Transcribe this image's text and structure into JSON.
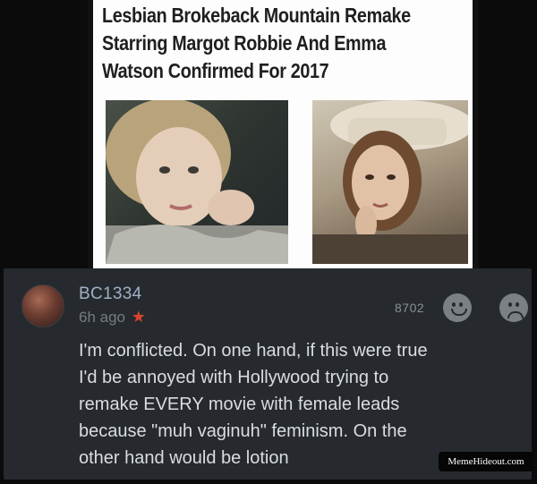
{
  "article": {
    "headline_lines": [
      "Lesbian Brokeback Mountain Remake",
      "Starring Margot Robbie And Emma",
      "Watson Confirmed For 2017"
    ],
    "image_left": "margot-robbie-photo",
    "image_right": "emma-watson-photo"
  },
  "comment": {
    "username": "BC1334",
    "time": "6h ago",
    "star_icon": "star-icon",
    "votes": "8702",
    "reaction_icons": [
      "smiley-icon",
      "sad-face-icon"
    ],
    "text_lines": [
      "I'm conflicted. On one hand, if this were true",
      "I'd be annoyed with Hollywood trying to",
      "remake EVERY movie with female leads",
      "because \"muh vaginuh\" feminism. On the",
      "other hand would be lotion"
    ]
  },
  "watermark": "MemeHideout.com",
  "colors": {
    "background": "#0b0b0b",
    "panel": "#262a2e",
    "username": "#9fb1c6",
    "star": "#d8452d",
    "comment_text": "#d9dde1"
  }
}
